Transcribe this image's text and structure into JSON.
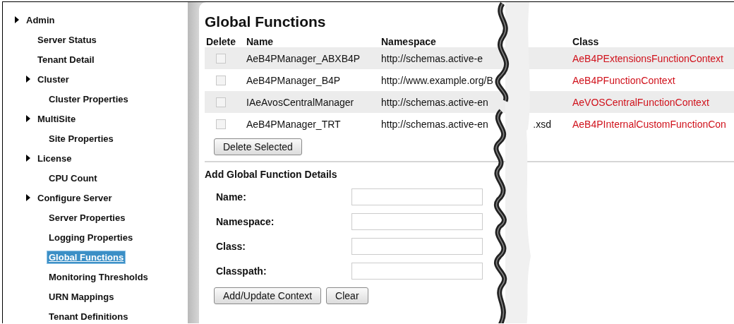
{
  "sidebar": {
    "items": [
      {
        "label": "Admin",
        "selected": false,
        "children": [
          {
            "label": "Server Status",
            "selected": false
          },
          {
            "label": "Tenant Detail",
            "selected": false
          },
          {
            "label": "Cluster",
            "selected": false,
            "children": [
              {
                "label": "Cluster Properties",
                "selected": false
              }
            ]
          },
          {
            "label": "MultiSite",
            "selected": false,
            "children": [
              {
                "label": "Site Properties",
                "selected": false
              }
            ]
          },
          {
            "label": "License",
            "selected": false,
            "children": [
              {
                "label": "CPU Count",
                "selected": false
              }
            ]
          },
          {
            "label": "Configure Server",
            "selected": false,
            "children": [
              {
                "label": "Server Properties",
                "selected": false
              },
              {
                "label": "Logging Properties",
                "selected": false
              },
              {
                "label": "Global Functions",
                "selected": true
              },
              {
                "label": "Monitoring Thresholds",
                "selected": false
              },
              {
                "label": "URN Mappings",
                "selected": false
              },
              {
                "label": "Tenant Definitions",
                "selected": false
              }
            ]
          }
        ]
      }
    ]
  },
  "main": {
    "title": "Global Functions",
    "table": {
      "columns": [
        "Delete",
        "Name",
        "Namespace",
        "Class"
      ],
      "rows": [
        {
          "checked": false,
          "name": "AeB4PManager_ABXB4P",
          "namespace": "http://schemas.active-e",
          "class": "AeB4PExtensionsFunctionContext"
        },
        {
          "checked": false,
          "name": "AeB4PManager_B4P",
          "namespace": "http://www.example.org/B",
          "class": "AeB4PFunctionContext"
        },
        {
          "checked": false,
          "name": "IAeAvosCentralManager",
          "namespace": "http://schemas.active-en",
          "class": "AeVOSCentralFunctionContext"
        },
        {
          "checked": false,
          "name": "AeB4PManager_TRT",
          "namespace": "http://schemas.active-en",
          "namespace_tail": ".xsd",
          "class": "AeB4PInternalCustomFunctionCon"
        }
      ]
    },
    "delete_button": "Delete Selected",
    "form": {
      "title": "Add Global Function Details",
      "fields": [
        {
          "label": "Name:"
        },
        {
          "label": "Namespace:"
        },
        {
          "label": "Class:"
        },
        {
          "label": "Classpath:"
        }
      ],
      "buttons": [
        "Add/Update Context",
        "Clear"
      ]
    }
  }
}
